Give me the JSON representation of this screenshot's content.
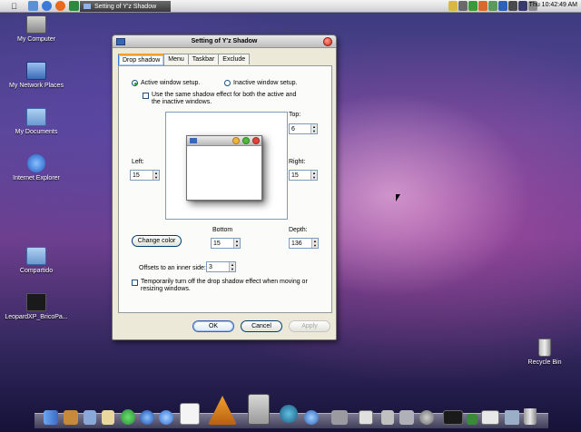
{
  "menubar": {
    "apple_icon": "apple-icon",
    "task_title": "Setting of Y'z Shadow",
    "clock": "Thu 10:42:49 AM"
  },
  "desktop": {
    "icons": [
      {
        "name": "my-computer",
        "label": "My Computer"
      },
      {
        "name": "my-network-places",
        "label": "My Network Places"
      },
      {
        "name": "my-documents",
        "label": "My Documents"
      },
      {
        "name": "internet-explorer",
        "label": "Internet Explorer"
      },
      {
        "name": "compartido",
        "label": "Compartido"
      },
      {
        "name": "leopardxp",
        "label": "LeopardXP_BricoPa..."
      },
      {
        "name": "recycle-bin",
        "label": "Recycle Bin"
      }
    ]
  },
  "dialog": {
    "title": "Setting of Y'z Shadow",
    "tabs": [
      "Drop shadow",
      "Menu",
      "Taskbar",
      "Exclude"
    ],
    "active_tab": "Drop shadow",
    "active_window_label": "Active window setup.",
    "inactive_window_label": "Inactive window setup.",
    "same_effect_label_1": "Use the same shadow effect for both the active and",
    "same_effect_label_2": "the inactive windows.",
    "left_label": "Left:",
    "left_value": "15",
    "top_label": "Top:",
    "top_value": "6",
    "right_label": "Right:",
    "right_value": "15",
    "bottom_label": "Bottom",
    "bottom_value": "15",
    "depth_label": "Depth:",
    "depth_value": "136",
    "change_color_label": "Change color",
    "offset_label": "Offsets to an inner side:",
    "offset_value": "3",
    "temp_off_label_1": "Temporarily turn off the drop shadow effect when moving or",
    "temp_off_label_2": "resizing windows.",
    "ok_label": "OK",
    "cancel_label": "Cancel",
    "apply_label": "Apply"
  },
  "colors": {
    "accent": "#3a7ad8",
    "tab_highlight": "#f0a030"
  }
}
